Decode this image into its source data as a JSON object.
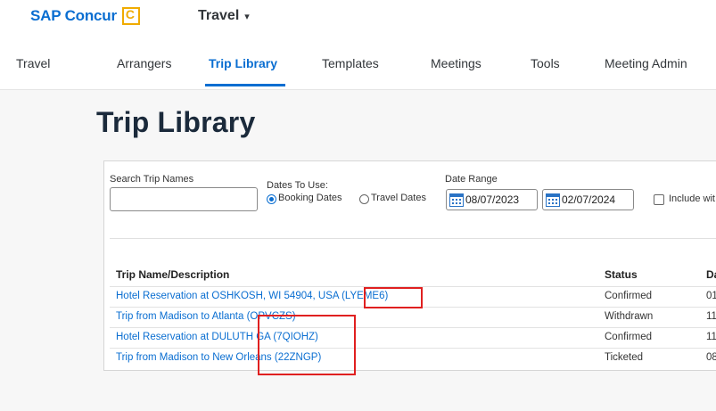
{
  "brand": {
    "name": "SAP Concur",
    "logo_letter": "C"
  },
  "app_menu": {
    "label": "Travel",
    "caret": "▾"
  },
  "nav": {
    "items": [
      {
        "label": "Travel",
        "active": false
      },
      {
        "label": "Arrangers",
        "active": false
      },
      {
        "label": "Trip Library",
        "active": true
      },
      {
        "label": "Templates",
        "active": false
      },
      {
        "label": "Meetings",
        "active": false
      },
      {
        "label": "Tools",
        "active": false
      },
      {
        "label": "Meeting Admin",
        "active": false
      }
    ]
  },
  "page": {
    "title": "Trip Library"
  },
  "filters": {
    "search_label": "Search Trip Names",
    "search_value": "",
    "dates_to_use_label": "Dates To Use:",
    "booking_dates_label": "Booking Dates",
    "travel_dates_label": "Travel Dates",
    "selected_date_type": "Booking Dates",
    "date_range_label": "Date Range",
    "date_from": "08/07/2023",
    "date_to": "02/07/2024",
    "include_label": "Include wit"
  },
  "table": {
    "headers": {
      "name": "Trip Name/Description",
      "status": "Status",
      "date": "Da"
    },
    "rows": [
      {
        "name": "Hotel Reservation at OSHKOSH, WI 54904, USA (LYEME6)",
        "status": "Confirmed",
        "date": "01"
      },
      {
        "name": "Trip from Madison to Atlanta (OPVCZS)",
        "status": "Withdrawn",
        "date": "11"
      },
      {
        "name": "Hotel Reservation at DULUTH GA (7QIOHZ)",
        "status": "Confirmed",
        "date": "11"
      },
      {
        "name": "Trip from Madison to New Orleans (22ZNGP)",
        "status": "Ticketed",
        "date": "08"
      }
    ]
  },
  "colors": {
    "accent": "#0a6ed1",
    "highlight": "#e02020",
    "logo": "#f0ab00"
  }
}
